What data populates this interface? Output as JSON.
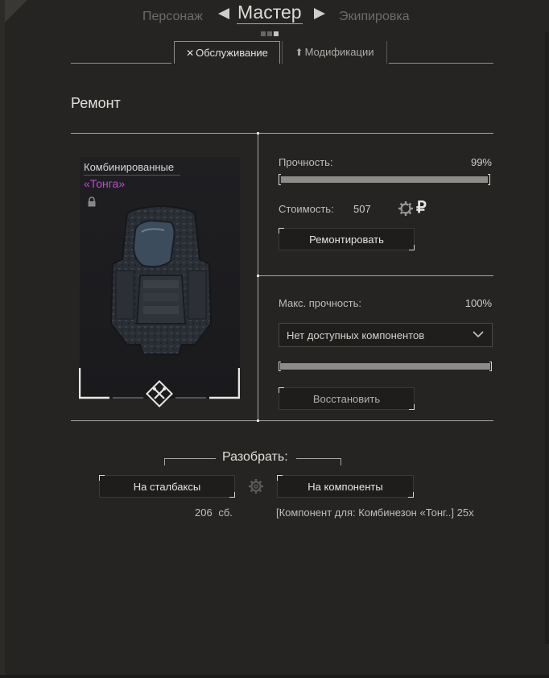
{
  "header": {
    "prev_label": "Персонаж",
    "title": "Мастер",
    "next_label": "Экипировка",
    "page_count": 3,
    "active_page": 3
  },
  "tabs": [
    {
      "label": "Обслуживание",
      "icon": "tools-icon",
      "active": true
    },
    {
      "label": "Модификации",
      "icon": "upgrade-arrow-icon",
      "active": false
    }
  ],
  "section_title": "Ремонт",
  "item": {
    "name": "Комбинированные",
    "subname": "«Тонга»",
    "name_color": "#c04bd0",
    "locked": true,
    "image": "armored-suit-image",
    "badge_icon": "repair-wrench-icon"
  },
  "repair": {
    "durability_label": "Прочность:",
    "durability_value": "99%",
    "durability_fraction": 0.99,
    "cost_label": "Стоимость:",
    "cost_value": "507",
    "cost_icons": [
      "gear-coin-icon",
      "ruble-icon"
    ],
    "ruble_symbol": "₽",
    "repair_button": "Ремонтировать"
  },
  "restore": {
    "max_durability_label": "Макс. прочность:",
    "max_durability_value": "100%",
    "max_durability_fraction": 1.0,
    "component_select": "Нет доступных компонентов",
    "restore_button": "Восстановить"
  },
  "disassemble": {
    "title": "Разобрать:",
    "to_stalbucks_button": "На сталбаксы",
    "to_components_button": "На компоненты",
    "stalbucks_amount": "206",
    "stalbucks_unit": "сб.",
    "components_text": "[Компонент для: Комбинезон «Тонг..] 25x"
  }
}
